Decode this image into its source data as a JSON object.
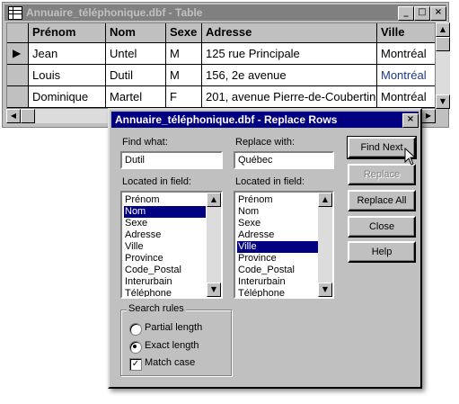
{
  "table_window": {
    "title": "Annuaire_téléphonique.dbf - Table",
    "buttons": {
      "minimize": "_",
      "maximize": "□",
      "close": "×"
    },
    "columns": [
      "Prénom",
      "Nom",
      "Sexe",
      "Adresse",
      "Ville"
    ],
    "rows": [
      {
        "prenom": "Jean",
        "nom": "Untel",
        "sexe": "M",
        "adresse": "125 rue Principale",
        "ville": "Montréal",
        "current": true
      },
      {
        "prenom": "Louis",
        "nom": "Dutil",
        "sexe": "M",
        "adresse": "156, 2e avenue",
        "ville": "Montréal"
      },
      {
        "prenom": "Dominique",
        "nom": "Martel",
        "sexe": "F",
        "adresse": "201, avenue Pierre-de-Coubertin",
        "ville": "Montréal"
      }
    ],
    "row_pointer": "▶"
  },
  "dialog": {
    "title": "Annuaire_téléphonique.dbf - Replace Rows",
    "close": "×",
    "find_what_label": "Find what:",
    "find_what_value": "Dutil",
    "replace_with_label": "Replace with:",
    "replace_with_value": "Québec",
    "located_in_field_label": "Located in field:",
    "fields": [
      "Prénom",
      "Nom",
      "Sexe",
      "Adresse",
      "Ville",
      "Province",
      "Code_Postal",
      "Interurbain",
      "Téléphone"
    ],
    "find_selected_field": "Nom",
    "replace_selected_field": "Ville",
    "buttons": {
      "find_next": "Find Next",
      "replace": "Replace",
      "replace_all": "Replace All",
      "close": "Close",
      "help": "Help"
    },
    "search_rules": {
      "title": "Search rules",
      "partial_length": "Partial length",
      "exact_length": "Exact length",
      "match_case": "Match case",
      "selected_rule": "exact_length",
      "match_case_checked": true
    }
  },
  "colors": {
    "active_title": "#000080",
    "inactive_title": "#808080",
    "face": "#c0c0c0"
  }
}
